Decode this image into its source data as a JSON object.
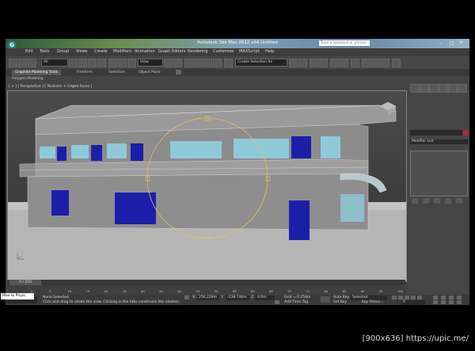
{
  "window": {
    "title": "Autodesk 3ds Max 2012 x64 Untitled",
    "search_placeholder": "Type a keyword or phrase"
  },
  "app_button": "G",
  "menu": [
    "Edit",
    "Tools",
    "Group",
    "Views",
    "Create",
    "Modifiers",
    "Animation",
    "Graph Editors",
    "Rendering",
    "Customize",
    "MAXScript",
    "Help"
  ],
  "toolbar": {
    "selection_filter": "All",
    "ref_coord": "View",
    "named_selection": "Create Selection Se"
  },
  "ribbon": {
    "tabs": [
      "Graphite Modeling Tools",
      "Freeform",
      "Selection",
      "Object Paint"
    ],
    "panel": "Polygon Modeling"
  },
  "viewport": {
    "label": "[ + ] [ Perspective ] [ Realistic + Edged Faces ]"
  },
  "command_panel": {
    "modifier_list": "Modifier List"
  },
  "timeline": {
    "frame": "0 / 100",
    "ticks": [
      "0",
      "5",
      "10",
      "15",
      "20",
      "25",
      "30",
      "35",
      "40",
      "45",
      "50",
      "55",
      "60",
      "65",
      "70",
      "75",
      "80",
      "85",
      "90",
      "95",
      "100"
    ]
  },
  "status": {
    "selection": "None Selected",
    "prompt": "Click and drag to rotate the view.  Clicking in the tabs constrains the rotation",
    "x": "256.229m",
    "y": "-238.746m",
    "z": "0.0m",
    "grid": "Grid = 0.254m",
    "auto_key": "Auto Key",
    "set_key": "Set Key",
    "key_mode": "Selected",
    "key_filters": "Key Filters...",
    "add_time_tag": "Add Time Tag",
    "frame_field": "0",
    "maxscript": "Max to Physc"
  },
  "watermark": "[900x636] https://upic.me/",
  "colors": {
    "window_glass": "#86a7c0",
    "blue_panels": "#1b1fa8",
    "glass": "#8fd3e6",
    "gizmo": "#e6c25a"
  }
}
